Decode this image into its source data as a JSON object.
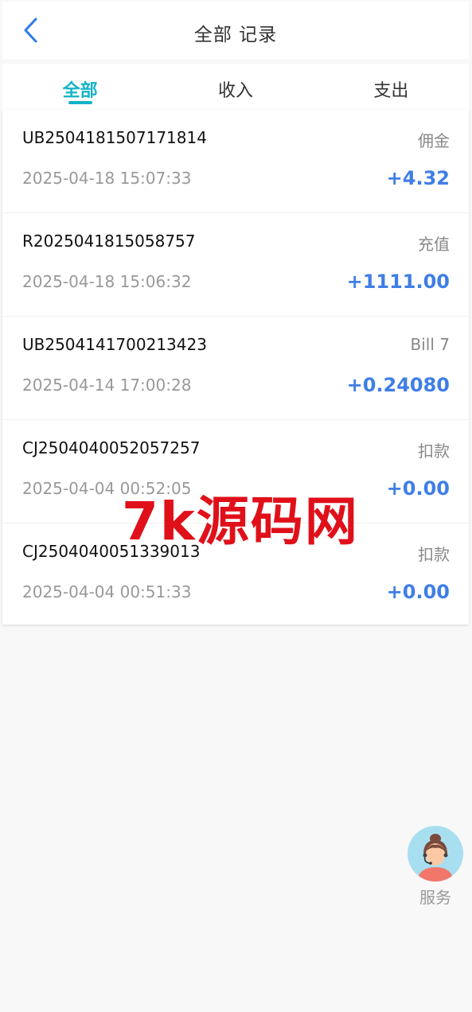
{
  "header": {
    "title": "全部 记录",
    "back_icon": "chevron-left-icon"
  },
  "tabs": [
    {
      "label": "全部",
      "active": true
    },
    {
      "label": "收入",
      "active": false
    },
    {
      "label": "支出",
      "active": false
    }
  ],
  "records": [
    {
      "id": "UB2504181507171814",
      "type": "佣金",
      "time": "2025-04-18 15:07:33",
      "amount": "+4.32"
    },
    {
      "id": "R2025041815058757",
      "type": "充值",
      "time": "2025-04-18 15:06:32",
      "amount": "+1111.00"
    },
    {
      "id": "UB2504141700213423",
      "type": "Bill 7",
      "time": "2025-04-14 17:00:28",
      "amount": "+0.24080"
    },
    {
      "id": "CJ2504040052057257",
      "type": "扣款",
      "time": "2025-04-04 00:52:05",
      "amount": "+0.00"
    },
    {
      "id": "CJ2504040051339013",
      "type": "扣款",
      "time": "2025-04-04 00:51:33",
      "amount": "+0.00"
    }
  ],
  "watermark": "7k源码网",
  "service": {
    "label": "服务",
    "icon": "customer-service-avatar-icon"
  },
  "colors": {
    "accent": "#13b3c8",
    "amount": "#3f7ee6",
    "watermark": "#e0101a",
    "back": "#2d7be5"
  }
}
